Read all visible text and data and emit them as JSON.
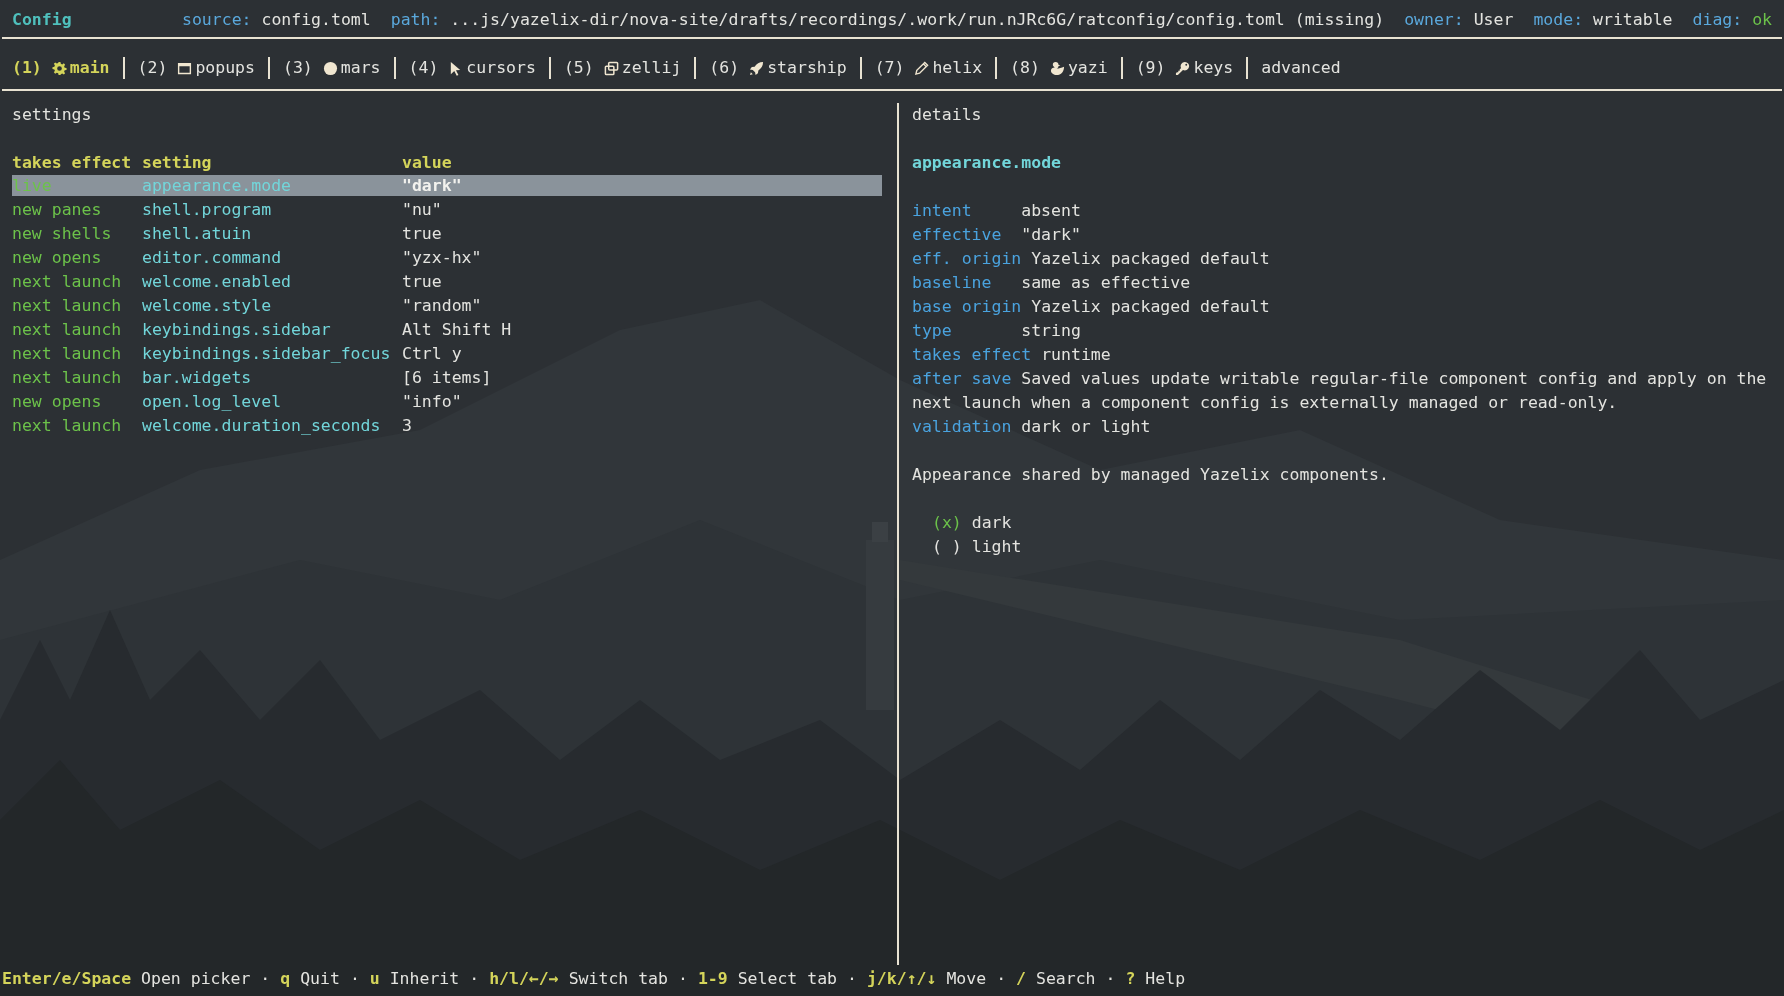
{
  "header": {
    "title": "Config",
    "fields": [
      {
        "label": "source:",
        "value": "config.toml",
        "kind": "plain"
      },
      {
        "label": "path:",
        "value": "...js/yazelix-dir/nova-site/drafts/recordings/.work/run.nJRc6G/ratconfig/config.toml (missing)",
        "kind": "plain"
      },
      {
        "label": "owner:",
        "value": "User",
        "kind": "plain"
      },
      {
        "label": "mode:",
        "value": "writable",
        "kind": "plain"
      },
      {
        "label": "diag:",
        "value": "ok",
        "kind": "status"
      }
    ]
  },
  "tabs": [
    {
      "number": "(1)",
      "label": "main",
      "selected": true
    },
    {
      "number": "(2)",
      "label": "popups",
      "selected": false
    },
    {
      "number": "(3)",
      "label": "mars",
      "selected": false
    },
    {
      "number": "(4)",
      "label": "cursors",
      "selected": false
    },
    {
      "number": "(5)",
      "label": "zellij",
      "selected": false
    },
    {
      "number": "(6)",
      "label": "starship",
      "selected": false
    },
    {
      "number": "(7)",
      "label": "helix",
      "selected": false
    },
    {
      "number": "(8)",
      "label": "yazi",
      "selected": false
    },
    {
      "number": "(9)",
      "label": "keys",
      "selected": false
    },
    {
      "label": "advanced",
      "selected": false
    }
  ],
  "settings": {
    "title": "settings",
    "columns": [
      "takes effect",
      "setting",
      "value"
    ],
    "rows": [
      {
        "effect": "live",
        "setting": "appearance.mode",
        "value": "\"dark\"",
        "selected": true
      },
      {
        "effect": "new panes",
        "setting": "shell.program",
        "value": "\"nu\"",
        "selected": false
      },
      {
        "effect": "new shells",
        "setting": "shell.atuin",
        "value": "true",
        "selected": false
      },
      {
        "effect": "new opens",
        "setting": "editor.command",
        "value": "\"yzx-hx\"",
        "selected": false
      },
      {
        "effect": "next launch",
        "setting": "welcome.enabled",
        "value": "true",
        "selected": false
      },
      {
        "effect": "next launch",
        "setting": "welcome.style",
        "value": "\"random\"",
        "selected": false
      },
      {
        "effect": "next launch",
        "setting": "keybindings.sidebar",
        "value": "Alt Shift H",
        "selected": false
      },
      {
        "effect": "next launch",
        "setting": "keybindings.sidebar_focus",
        "value": "Ctrl y",
        "selected": false
      },
      {
        "effect": "next launch",
        "setting": "bar.widgets",
        "value": "[6 items]",
        "selected": false
      },
      {
        "effect": "new opens",
        "setting": "open.log_level",
        "value": "\"info\"",
        "selected": false
      },
      {
        "effect": "next launch",
        "setting": "welcome.duration_seconds",
        "value": "3",
        "selected": false
      }
    ]
  },
  "details": {
    "title": "details",
    "setting": "appearance.mode",
    "fields": [
      {
        "label": "intent",
        "value": "absent"
      },
      {
        "label": "effective",
        "value": "\"dark\""
      },
      {
        "label": "eff. origin",
        "value": "Yazelix packaged default"
      },
      {
        "label": "baseline",
        "value": "same as effective"
      },
      {
        "label": "base origin",
        "value": "Yazelix packaged default"
      },
      {
        "label": "type",
        "value": "string"
      },
      {
        "label": "takes effect",
        "value": "runtime"
      },
      {
        "label": "after save",
        "value": "Saved values update writable regular-file component config and apply on the next launch when a component config is externally managed or read-only."
      },
      {
        "label": "validation",
        "value": "dark or light"
      }
    ],
    "description": "Appearance shared by managed Yazelix components.",
    "options": [
      {
        "marker": "(x)",
        "label": "dark",
        "selected": true
      },
      {
        "marker": "( )",
        "label": "light",
        "selected": false
      }
    ]
  },
  "footer": [
    {
      "kind": "hint",
      "key": "Enter/e/Space",
      "action": "Open picker"
    },
    {
      "kind": "separator",
      "text": "·"
    },
    {
      "kind": "hint",
      "key": "q",
      "action": "Quit"
    },
    {
      "kind": "separator",
      "text": "·"
    },
    {
      "kind": "hint",
      "key": "u",
      "action": "Inherit"
    },
    {
      "kind": "separator",
      "text": "·"
    },
    {
      "kind": "hint",
      "key": "h/l/←/→",
      "action": "Switch tab"
    },
    {
      "kind": "separator",
      "text": "·"
    },
    {
      "kind": "hint",
      "key": "1-9",
      "action": "Select tab"
    },
    {
      "kind": "separator",
      "text": "·"
    },
    {
      "kind": "hint",
      "key": "j/k/↑/↓",
      "action": "Move"
    },
    {
      "kind": "separator",
      "text": "·"
    },
    {
      "kind": "hint",
      "key": "/",
      "action": "Search"
    },
    {
      "kind": "separator",
      "text": "·"
    },
    {
      "kind": "hint",
      "key": "?",
      "action": "Help"
    }
  ]
}
